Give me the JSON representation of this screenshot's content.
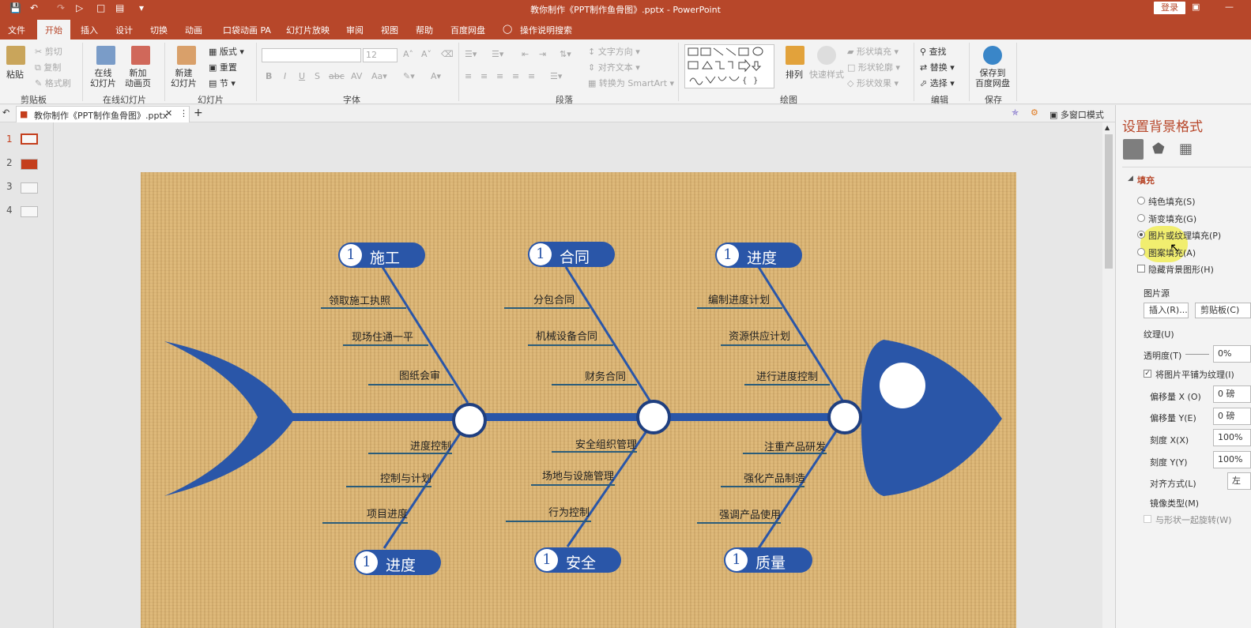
{
  "app": {
    "title": "教你制作《PPT制作鱼骨图》.pptx  -  PowerPoint",
    "login": "登录"
  },
  "tabs": [
    "文件",
    "开始",
    "插入",
    "设计",
    "切换",
    "动画",
    "口袋动画 PA",
    "幻灯片放映",
    "审阅",
    "视图",
    "帮助",
    "百度网盘"
  ],
  "tell_me": "操作说明搜索",
  "ribbon": {
    "clipboard": {
      "paste": "粘贴",
      "cut": "剪切",
      "copy": "复制",
      "format_painter": "格式刷",
      "label": "剪贴板"
    },
    "online": {
      "online_slide": "在线\n幻灯片",
      "new_anim": "新加\n动画页",
      "label": "在线幻灯片"
    },
    "slides": {
      "new_slide": "新建\n幻灯片",
      "layout": "版式",
      "reset": "重置",
      "section": "节",
      "label": "幻灯片"
    },
    "font": {
      "size": "12",
      "label": "字体"
    },
    "paragraph": {
      "text_dir": "文字方向",
      "align_text": "对齐文本",
      "smartart": "转换为 SmartArt",
      "label": "段落"
    },
    "drawing": {
      "arrange": "排列",
      "quick_styles": "快速样式",
      "shape_fill": "形状填充",
      "shape_outline": "形状轮廓",
      "shape_effects": "形状效果",
      "label": "绘图"
    },
    "editing": {
      "find": "查找",
      "replace": "替换",
      "select": "选择",
      "label": "编辑"
    },
    "save": {
      "save_baidu": "保存到\n百度网盘",
      "label": "保存"
    }
  },
  "doc_tab": "教你制作《PPT制作鱼骨图》.pptx",
  "multi_window": "多窗口模式",
  "slides": [
    {
      "num": "1",
      "selected": true
    },
    {
      "num": "2",
      "selected": false
    },
    {
      "num": "3",
      "selected": false
    },
    {
      "num": "4",
      "selected": false
    }
  ],
  "fishbone": {
    "categories": [
      {
        "num": "1",
        "title": "施工",
        "items": [
          "领取施工执照",
          "现场住通一平",
          "图纸会审"
        ]
      },
      {
        "num": "1",
        "title": "合同",
        "items": [
          "分包合同",
          "机械设备合同",
          "财务合同"
        ]
      },
      {
        "num": "1",
        "title": "进度",
        "items": [
          "编制进度计划",
          "资源供应计划",
          "进行进度控制"
        ]
      },
      {
        "num": "1",
        "title": "进度",
        "items": [
          "进度控制",
          "控制与计划",
          "项目进度"
        ]
      },
      {
        "num": "1",
        "title": "安全",
        "items": [
          "安全组织管理",
          "场地与设施管理",
          "行为控制"
        ]
      },
      {
        "num": "1",
        "title": "质量",
        "items": [
          "注重产品研发",
          "强化产品制造",
          "强调产品使用"
        ]
      }
    ],
    "colors": {
      "bone": "#2a56a8",
      "background": "#dcb676"
    }
  },
  "format_pane": {
    "title": "设置背景格式",
    "section": "填充",
    "options": [
      {
        "label": "纯色填充(S)",
        "checked": false
      },
      {
        "label": "渐变填充(G)",
        "checked": false
      },
      {
        "label": "图片或纹理填充(P)",
        "checked": true
      },
      {
        "label": "图案填充(A)",
        "checked": false
      }
    ],
    "hide_bg": "隐藏背景图形(H)",
    "pic_source": "图片源",
    "insert": "插入(R)...",
    "clipboard": "剪贴板(C)",
    "texture": "纹理(U)",
    "transparency_label": "透明度(T)",
    "transparency_value": "0%",
    "tile": "将图片平铺为纹理(I)",
    "offset_x_label": "偏移量 X (O)",
    "offset_x_value": "0 磅",
    "offset_y_label": "偏移量 Y(E)",
    "offset_y_value": "0 磅",
    "scale_x_label": "刻度 X(X)",
    "scale_x_value": "100%",
    "scale_y_label": "刻度 Y(Y)",
    "scale_y_value": "100%",
    "align_label": "对齐方式(L)",
    "align_value": "左",
    "mirror_label": "镜像类型(M)",
    "rotate_with": "与形状一起旋转(W)"
  }
}
